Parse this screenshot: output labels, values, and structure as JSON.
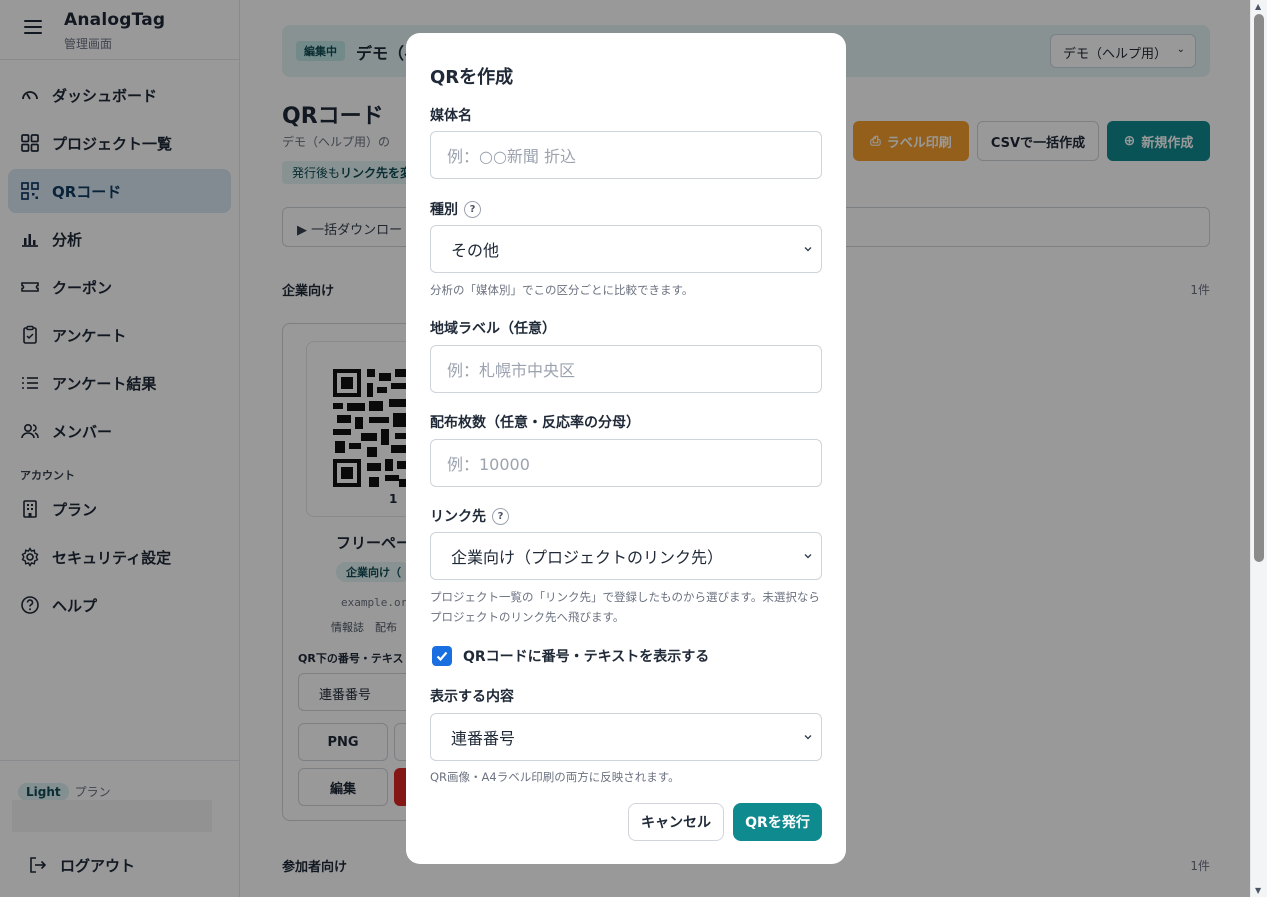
{
  "sidebar": {
    "brand": "AnalogTag",
    "brand_sub": "管理画面",
    "items": [
      {
        "label": "ダッシュボード",
        "icon": "gauge-icon"
      },
      {
        "label": "プロジェクト一覧",
        "icon": "grid-icon"
      },
      {
        "label": "QRコード",
        "icon": "qr-icon",
        "active": true
      },
      {
        "label": "分析",
        "icon": "bar-chart-icon"
      },
      {
        "label": "クーポン",
        "icon": "ticket-icon"
      },
      {
        "label": "アンケート",
        "icon": "clipboard-icon"
      },
      {
        "label": "アンケート結果",
        "icon": "list-icon"
      },
      {
        "label": "メンバー",
        "icon": "users-icon"
      }
    ],
    "account_label": "アカウント",
    "account_items": [
      {
        "label": "プラン",
        "icon": "building-icon"
      },
      {
        "label": "セキュリティ設定",
        "icon": "gear-icon"
      },
      {
        "label": "ヘルプ",
        "icon": "help-circle-icon"
      }
    ],
    "plan_badge": "Light",
    "plan_text": "プラン",
    "logout": "ログアウト"
  },
  "main": {
    "edit_chip": "編集中",
    "edit_title": "デモ（ヘ",
    "project_select": "デモ（ヘルプ用）",
    "page_title": "QRコード",
    "page_desc": "デモ（ヘルプ用）の",
    "info_chip_pre": "発行後も",
    "info_chip_bold": "リンク先を変",
    "buttons": {
      "print": "ラベル印刷",
      "csv": "CSVで一括作成",
      "new": "新規作成"
    },
    "bulk_download": "▶ 一括ダウンロー",
    "group1": {
      "title": "企業向け",
      "count": "1件"
    },
    "group2": {
      "title": "参加者向け",
      "count": "1件"
    },
    "card": {
      "qr_number": "1",
      "name": "フリーペー",
      "chip": "企業向け（",
      "url": "example.or",
      "meta": "情報誌　配布",
      "label": "QR下の番号・テキス",
      "select": "連番番号",
      "png": "PNG",
      "edit": "編集"
    }
  },
  "modal": {
    "title": "QRを作成",
    "media_label": "媒体名",
    "media_placeholder": "例：○○新聞 折込",
    "type_label": "種別",
    "type_value": "その他",
    "type_hint": "分析の「媒体別」でこの区分ごとに比較できます。",
    "region_label": "地域ラベル（任意）",
    "region_placeholder": "例：札幌市中央区",
    "count_label": "配布枚数（任意・反応率の分母）",
    "count_placeholder": "例：10000",
    "link_label": "リンク先",
    "link_value": "企業向け（プロジェクトのリンク先）",
    "link_hint": "プロジェクト一覧の「リンク先」で登録したものから選びます。未選択ならプロジェクトのリンク先へ飛びます。",
    "show_text_label": "QRコードに番号・テキストを表示する",
    "show_text_checked": true,
    "content_label": "表示する内容",
    "content_value": "連番番号",
    "content_hint": "QR画像・A4ラベル印刷の両方に反映されます。",
    "cancel": "キャンセル",
    "submit": "QRを発行",
    "help_mark": "?"
  },
  "colors": {
    "accent": "#0f8a8f",
    "print": "#f59e2c",
    "active_nav": "#d9e7f3",
    "checkbox": "#1a6fe0"
  }
}
